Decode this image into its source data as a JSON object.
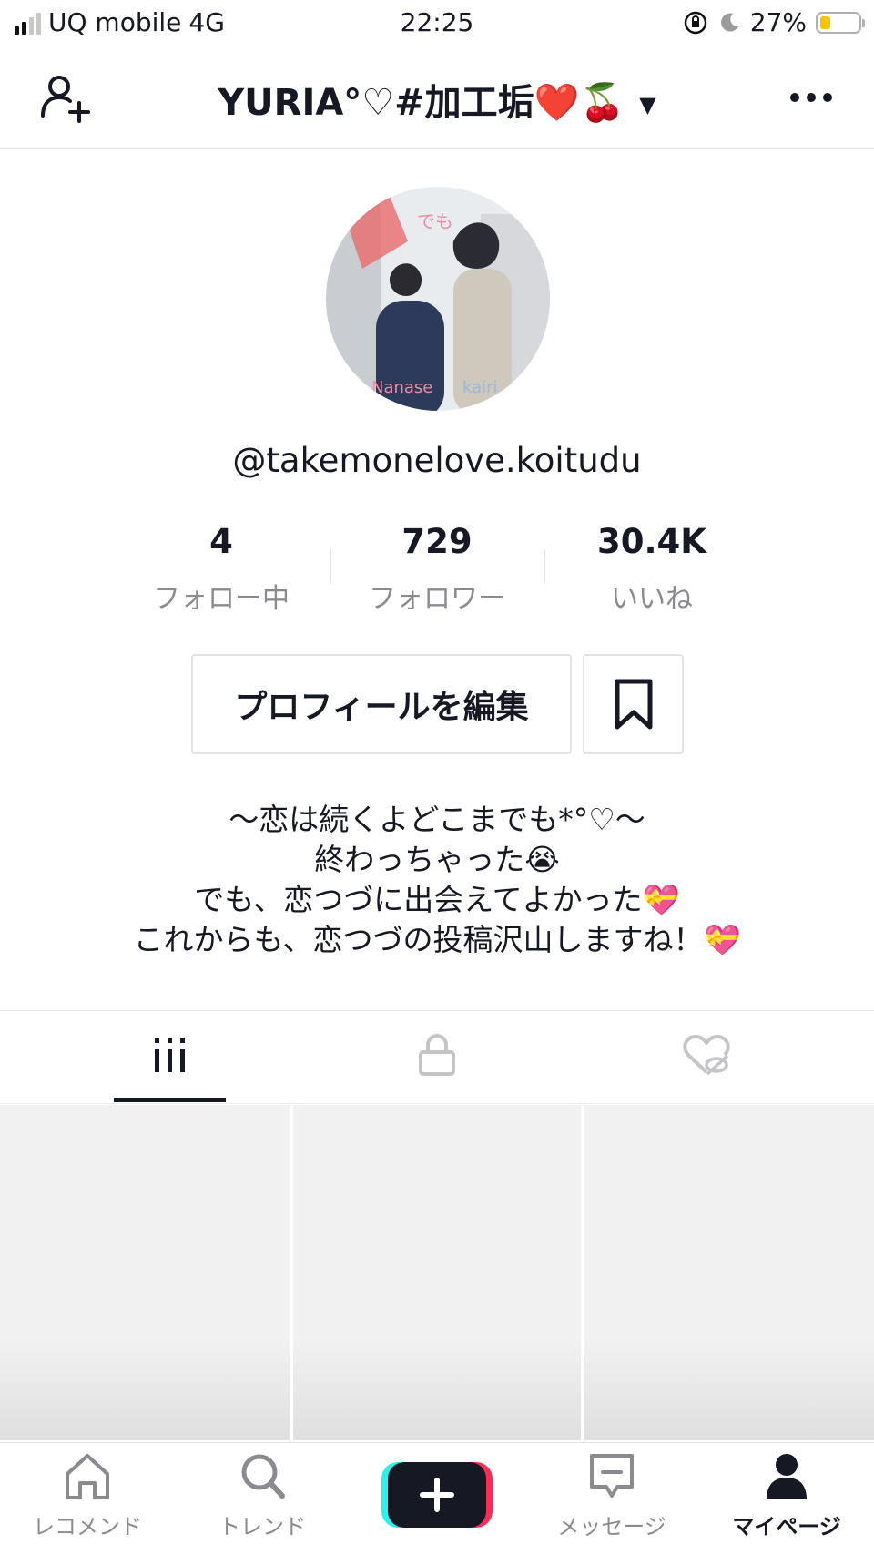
{
  "status_bar": {
    "carrier": "UQ mobile",
    "network": "4G",
    "time": "22:25",
    "battery_percent": "27%",
    "battery_level": 0.27
  },
  "header": {
    "title": "YURIA°♡#加工垢❤️🍒",
    "add_user_icon": "person-add-icon",
    "menu_icon": "more-horizontal-icon"
  },
  "profile": {
    "username": "@takemonelove.koitudu",
    "avatar_caption_left": "Nanase",
    "avatar_caption_right": "kairi",
    "avatar_overlay_text": "でも"
  },
  "stats": [
    {
      "value": "4",
      "label": "フォロー中"
    },
    {
      "value": "729",
      "label": "フォロワー"
    },
    {
      "value": "30.4K",
      "label": "いいね"
    }
  ],
  "actions": {
    "edit_profile": "プロフィールを編集",
    "bookmark_icon": "bookmark-icon"
  },
  "bio": [
    "〜恋は続くよどこまでも*°♡〜",
    "終わっちゃった😭",
    "でも、恋つづに出会えてよかった💝",
    "これからも、恋つづの投稿沢山しますね！💝"
  ],
  "tabs": [
    {
      "icon": "grid-icon",
      "active": true
    },
    {
      "icon": "lock-icon",
      "active": false
    },
    {
      "icon": "liked-hidden-icon",
      "active": false
    }
  ],
  "bottom_nav": [
    {
      "label": "レコメンド",
      "icon": "home-icon"
    },
    {
      "label": "トレンド",
      "icon": "search-icon"
    },
    {
      "label": "",
      "icon": "plus-icon"
    },
    {
      "label": "メッセージ",
      "icon": "message-icon"
    },
    {
      "label": "マイページ",
      "icon": "profile-icon",
      "active": true
    }
  ]
}
